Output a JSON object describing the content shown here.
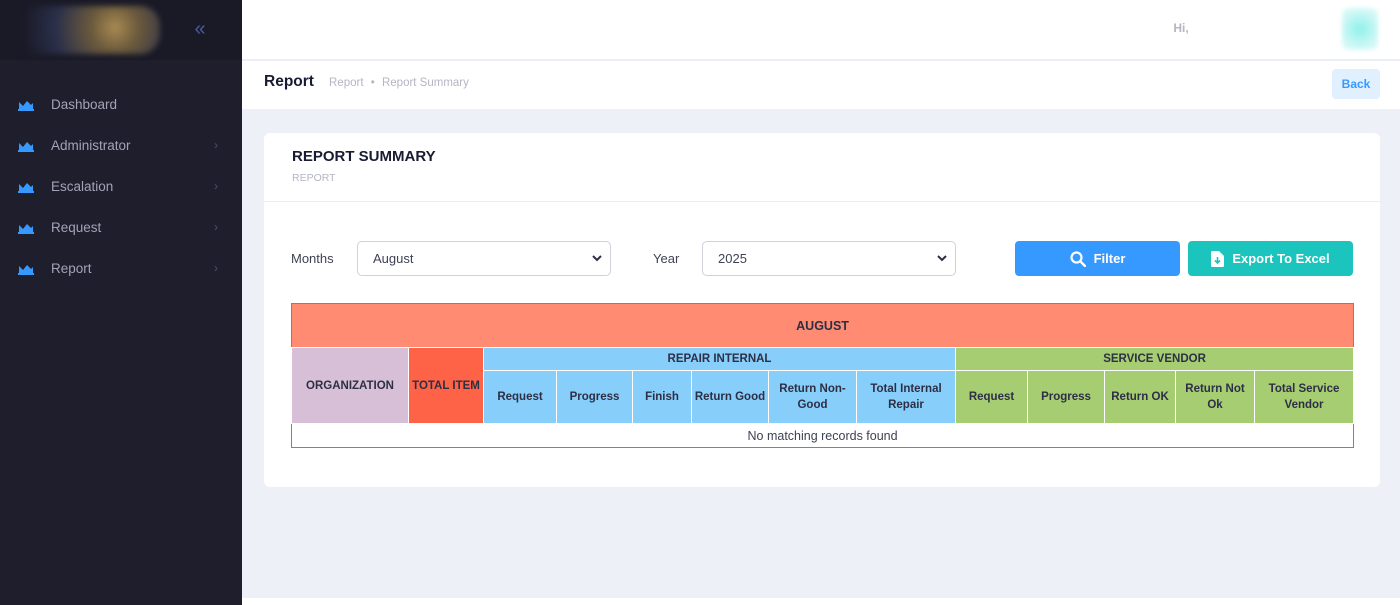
{
  "sidebar": {
    "collapse_glyph": "«",
    "items": [
      {
        "label": "Dashboard",
        "icon": "chart-area-icon",
        "has_submenu": false
      },
      {
        "label": "Administrator",
        "icon": "chart-area-icon",
        "has_submenu": true
      },
      {
        "label": "Escalation",
        "icon": "chart-area-icon",
        "has_submenu": true
      },
      {
        "label": "Request",
        "icon": "chart-area-icon",
        "has_submenu": true
      },
      {
        "label": "Report",
        "icon": "chart-area-icon",
        "has_submenu": true
      }
    ]
  },
  "topbar": {
    "greeting": "Hi,"
  },
  "subheader": {
    "title": "Report",
    "breadcrumb": [
      "Report",
      "Report Summary"
    ],
    "back_label": "Back"
  },
  "card": {
    "title": "REPORT SUMMARY",
    "subtitle": "REPORT"
  },
  "filters": {
    "months_label": "Months",
    "months_value": "August",
    "year_label": "Year",
    "year_value": "2025",
    "filter_button": "Filter",
    "export_button": "Export To Excel"
  },
  "table": {
    "month_header": "AUGUST",
    "organization": "ORGANIZATION",
    "total_item": "TOTAL ITEM",
    "repair_internal": {
      "title": "REPAIR INTERNAL",
      "columns": [
        "Request",
        "Progress",
        "Finish",
        "Return Good",
        "Return Non-Good",
        "Total Internal Repair"
      ]
    },
    "service_vendor": {
      "title": "SERVICE VENDOR",
      "columns": [
        "Request",
        "Progress",
        "Return OK",
        "Return Not Ok",
        "Total Service Vendor"
      ]
    },
    "empty_message": "No matching records found"
  },
  "colors": {
    "sidebar_bg": "#1e1e2d",
    "primary": "#3699ff",
    "export": "#1bc5bd",
    "month_header": "#ff8b73",
    "organization": "#d8bfd8",
    "total_item": "#ff6347",
    "repair_internal": "#87cefa",
    "service_vendor": "#a6cd72"
  }
}
